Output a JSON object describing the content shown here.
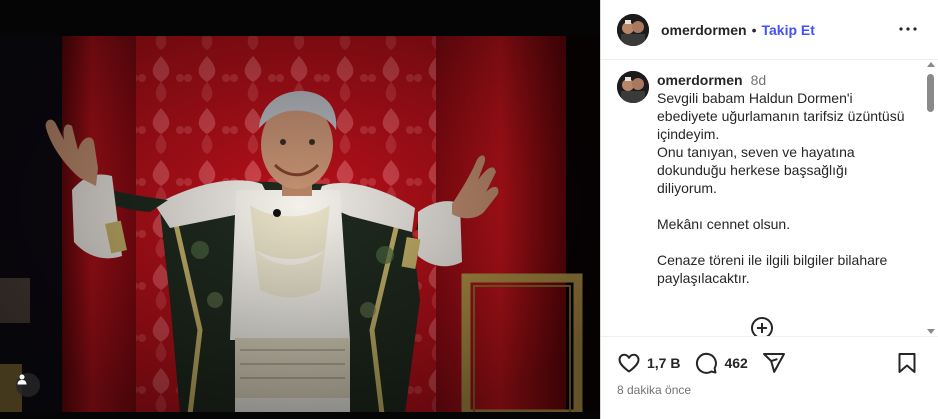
{
  "post": {
    "username": "omerdormen",
    "dot": "•",
    "follow_label": "Takip Et",
    "caption": {
      "username": "omerdormen",
      "time": "8d",
      "lines": [
        "Sevgili babam Haldun Dormen'i",
        "ebediyete uğurlamanın tarifsiz üzüntüsü",
        "içindeyim.",
        "Onu tanıyan, seven ve hayatına",
        "dokunduğu herkese başsağlığı",
        "diliyorum.",
        "",
        "Mekânı cennet olsun.",
        "",
        "Cenaze töreni ile ilgili bilgiler bilahare",
        "paylaşılacaktır."
      ]
    },
    "likes": "1,7 B",
    "comments": "462",
    "time_ago": "8 dakika önce"
  },
  "icons": {
    "more": "more-horizontal-icon",
    "heart": "heart-icon",
    "comment": "comment-icon",
    "share": "share-icon",
    "save": "bookmark-icon",
    "add": "plus-circle-icon",
    "tag": "user-tag-icon"
  },
  "colors": {
    "follow": "#4150f7",
    "curtain_red": "#c8141c",
    "text": "#262626",
    "muted": "#737373"
  }
}
